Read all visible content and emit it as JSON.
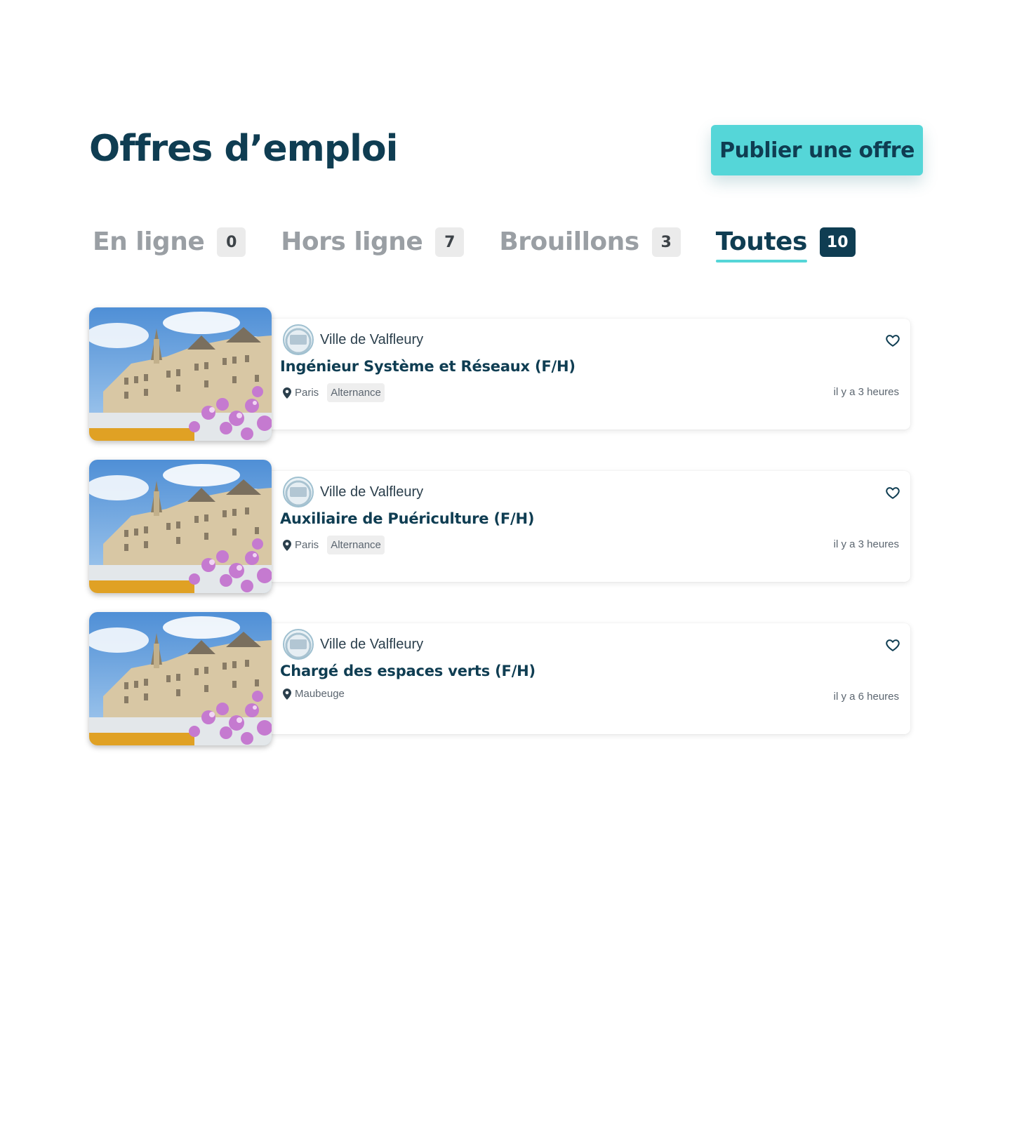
{
  "header": {
    "title": "Offres d’emploi",
    "publish_label": "Publier une offre"
  },
  "tabs": [
    {
      "label": "En ligne",
      "count": "0",
      "active": false
    },
    {
      "label": "Hors ligne",
      "count": "7",
      "active": false
    },
    {
      "label": "Brouillons",
      "count": "3",
      "active": false
    },
    {
      "label": "Toutes",
      "count": "10",
      "active": true
    }
  ],
  "jobs": [
    {
      "organization": "Ville de Valfleury",
      "title": "Ingénieur Système et Réseaux (F/H)",
      "location": "Paris",
      "contract": "Alternance",
      "posted": "il y a 3 heures"
    },
    {
      "organization": "Ville de Valfleury",
      "title": "Auxiliaire de Puériculture (F/H)",
      "location": "Paris",
      "contract": "Alternance",
      "posted": "il y a 3 heures"
    },
    {
      "organization": "Ville de Valfleury",
      "title": "Chargé des espaces verts (F/H)",
      "location": "Maubeuge",
      "contract": "",
      "posted": "il y a 6 heures"
    }
  ],
  "colors": {
    "primary": "#0f3d52",
    "accent": "#55d6d8",
    "muted": "#9a9fa4"
  },
  "icons": {
    "favorite": "heart-outline-icon",
    "location": "map-pin-icon"
  }
}
